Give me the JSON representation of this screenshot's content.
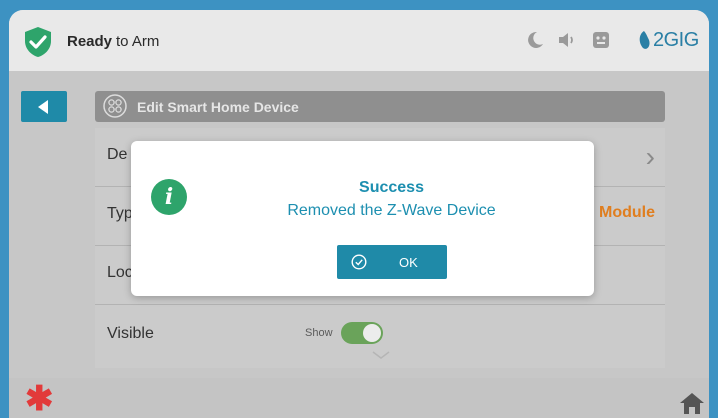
{
  "status": {
    "ready": "Ready",
    "rest": "to Arm"
  },
  "brand": {
    "logo_text": "2GIG"
  },
  "header": {
    "title": "Edit Smart Home Device"
  },
  "rows": [
    {
      "label": "De"
    },
    {
      "label": "Typ",
      "value": "Module"
    },
    {
      "label": "Loc"
    },
    {
      "label": "Visible",
      "toggle_label": "Show"
    }
  ],
  "dialog": {
    "title": "Success",
    "message": "Removed the Z-Wave Device",
    "ok_label": "OK"
  },
  "colors": {
    "accent": "#1f8aa8",
    "success": "#2ea46b",
    "warning_text": "#e07e1f",
    "alert": "#e23a3a"
  }
}
